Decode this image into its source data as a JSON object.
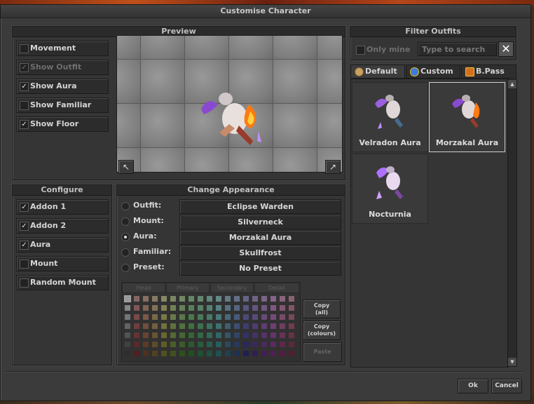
{
  "window": {
    "title": "Customise Character"
  },
  "preview": {
    "title": "Preview",
    "options": [
      {
        "label": "Movement",
        "checked": false,
        "disabled": false
      },
      {
        "label": "Show Outfit",
        "checked": true,
        "disabled": true
      },
      {
        "label": "Show Aura",
        "checked": true,
        "disabled": false
      },
      {
        "label": "Show Familiar",
        "checked": false,
        "disabled": false
      },
      {
        "label": "Show Floor",
        "checked": true,
        "disabled": false
      }
    ],
    "rotate_left_icon": "rotate-left-icon",
    "rotate_right_icon": "rotate-right-icon"
  },
  "configure": {
    "title": "Configure",
    "options": [
      {
        "label": "Addon 1",
        "checked": true
      },
      {
        "label": "Addon 2",
        "checked": true
      },
      {
        "label": "Aura",
        "checked": true
      },
      {
        "label": "Mount",
        "checked": false
      },
      {
        "label": "Random Mount",
        "checked": false
      }
    ]
  },
  "appearance": {
    "title": "Change Appearance",
    "rows": [
      {
        "label": "Outfit:",
        "value": "Eclipse Warden",
        "selected": false
      },
      {
        "label": "Mount:",
        "value": "Silverneck",
        "selected": false
      },
      {
        "label": "Aura:",
        "value": "Morzakal Aura",
        "selected": true
      },
      {
        "label": "Familiar:",
        "value": "Skullfrost",
        "selected": false
      },
      {
        "label": "Preset:",
        "value": "No Preset",
        "selected": false
      }
    ],
    "color_tabs": [
      "Head",
      "Primary",
      "Secondary",
      "Detail"
    ],
    "copy_all": "Copy\n(all)",
    "copy_colours": "Copy\n(colours)",
    "paste": "Paste"
  },
  "filter": {
    "title": "Filter Outfits",
    "only_mine": "Only mine",
    "search_placeholder": "Type to search",
    "clear_icon": "close-icon"
  },
  "tabs": [
    {
      "label": "Default",
      "active": true,
      "color": "#c8a060"
    },
    {
      "label": "Custom",
      "active": false,
      "color": "#3d7bd8"
    },
    {
      "label": "B.Pass",
      "active": false,
      "color": "#d2701e"
    }
  ],
  "outfits": [
    {
      "name": "Velradon Aura",
      "selected": false
    },
    {
      "name": "Morzakal Aura",
      "selected": true
    },
    {
      "name": "Nocturnia",
      "selected": false
    }
  ],
  "buttons": {
    "ok": "Ok",
    "cancel": "Cancel"
  },
  "colors": {
    "accent": "#d0d0d0",
    "panel": "#353535",
    "window": "#3b3b3b"
  }
}
